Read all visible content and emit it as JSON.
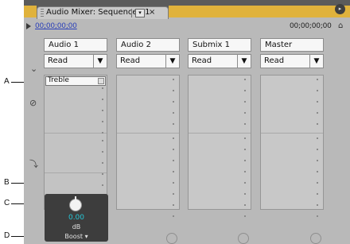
{
  "panel": {
    "tab_title": "Audio Mixer: Sequence 01",
    "tab_menu_glyph": "▾",
    "close_glyph": "×",
    "panel_menu_glyph": "▸",
    "timecode_current": "00;00;00;00",
    "timecode_duration": "00;00;00;00",
    "home_glyph": "⌂"
  },
  "tracks": [
    {
      "name": "Audio 1",
      "mode": "Read"
    },
    {
      "name": "Audio 2",
      "mode": "Read"
    },
    {
      "name": "Submix 1",
      "mode": "Read"
    },
    {
      "name": "Master",
      "mode": "Read"
    }
  ],
  "mode_arrow": "▼",
  "effect": {
    "name": "Treble",
    "knob_value": "0.00",
    "unit": "dB",
    "parameter": "Boost",
    "parameter_arrow": "▾",
    "bypass_glyph": "⊘"
  },
  "callouts": {
    "a": "A",
    "b": "B",
    "c": "C",
    "d": "D"
  },
  "icons": {
    "effects_toggle": "⊘",
    "sends_toggle": "⤵",
    "collapse": "⌄"
  }
}
